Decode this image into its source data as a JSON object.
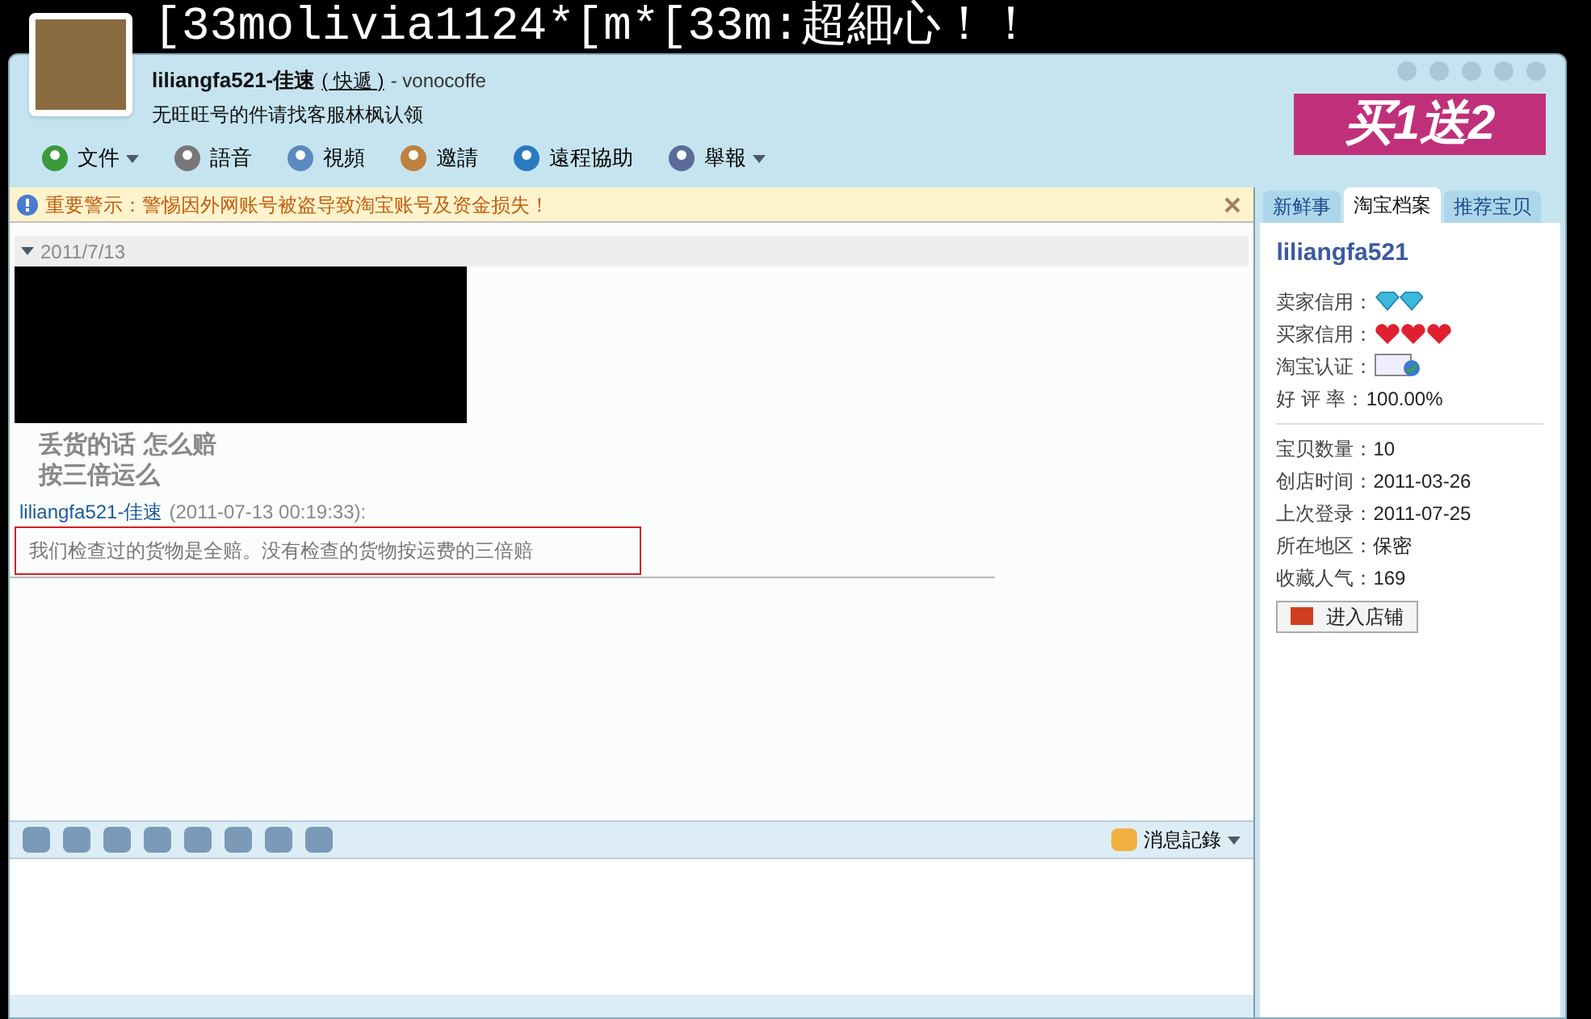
{
  "background_text": "[33molivia1124*[m*[33m:超細心！！",
  "contact": {
    "name": "liliangfa521-佳速",
    "status": "( 快遞 )",
    "suffix": "- vonocoffe",
    "signature": "无旺旺号的件请找客服林枫认领"
  },
  "ad_banner": "买1送2",
  "toolbar": [
    {
      "label": "文件",
      "kind": "menu"
    },
    {
      "label": "語音",
      "kind": "plain"
    },
    {
      "label": "視頻",
      "kind": "plain"
    },
    {
      "label": "邀請",
      "kind": "plain"
    },
    {
      "label": "遠程協助",
      "kind": "plain"
    },
    {
      "label": "舉報",
      "kind": "menu"
    }
  ],
  "warning": {
    "text": "重要警示：警惕因外网账号被盗导致淘宝账号及资金损失！"
  },
  "chat": {
    "date": "2011/7/13",
    "quoted_lines": [
      "丢货的话 怎么赔",
      "按三倍运么"
    ],
    "sender": "liliangfa521-佳速",
    "time": "(2011-07-13 00:19:33):",
    "message": "我们检查过的货物是全赔。没有检查的货物按运费的三倍赔"
  },
  "history_button": "消息記錄",
  "tabs": [
    {
      "label": "新鲜事",
      "selected": false
    },
    {
      "label": "淘宝档案",
      "selected": true
    },
    {
      "label": "推荐宝贝",
      "selected": false
    }
  ],
  "profile": {
    "username": "liliangfa521",
    "credit_rows": [
      {
        "label": "卖家信用：",
        "kind": "diamonds"
      },
      {
        "label": "买家信用：",
        "kind": "hearts"
      },
      {
        "label": "淘宝认证：",
        "kind": "badge"
      },
      {
        "label": "好 评 率：",
        "kind": "text",
        "value": "100.00%"
      }
    ],
    "stats": [
      {
        "label": "宝贝数量：",
        "value": "10"
      },
      {
        "label": "创店时间：",
        "value": "2011-03-26"
      },
      {
        "label": "上次登录：",
        "value": "2011-07-25"
      },
      {
        "label": "所在地区：",
        "value": "保密"
      },
      {
        "label": "收藏人气：",
        "value": "169"
      }
    ],
    "shop_button": "进入店铺"
  }
}
